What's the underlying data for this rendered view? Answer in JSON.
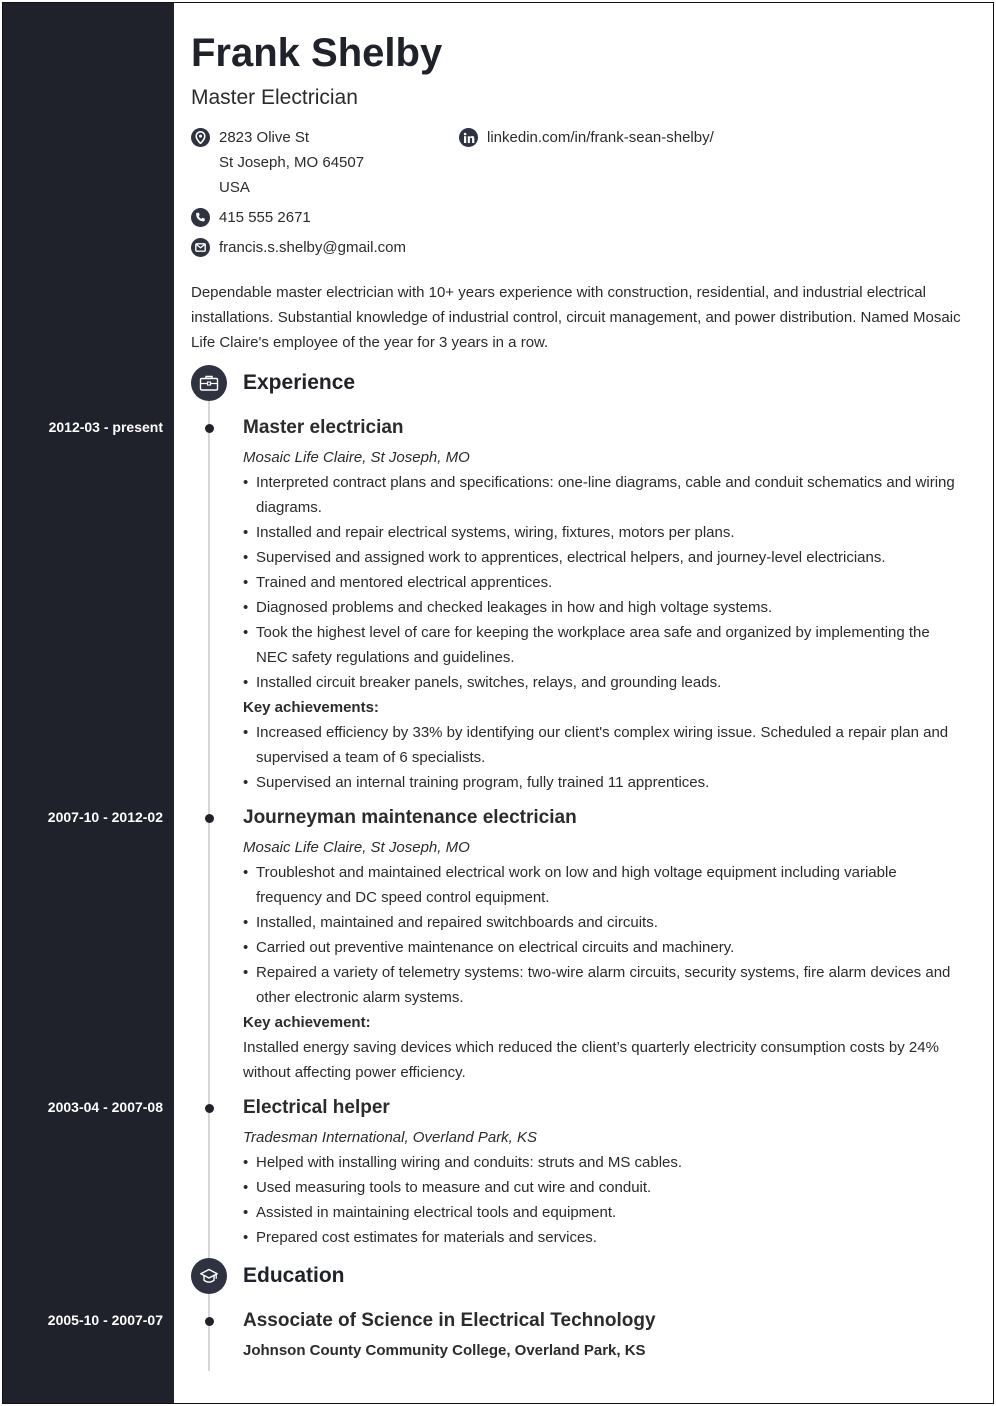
{
  "header": {
    "name": "Frank Shelby",
    "title": "Master Electrician"
  },
  "contact": {
    "address_line1": "2823 Olive St",
    "address_line2": "St Joseph, MO 64507",
    "address_line3": "USA",
    "phone": "415 555 2671",
    "email": "francis.s.shelby@gmail.com",
    "linkedin": "linkedin.com/in/frank-sean-shelby/",
    "icons": [
      "location-icon",
      "phone-icon",
      "email-icon",
      "linkedin-icon"
    ]
  },
  "summary": "Dependable master electrician with 10+ years experience with construction, residential, and industrial electrical installations. Substantial knowledge of industrial control, circuit management, and power distribution. Named Mosaic Life Claire's employee of the year for 3 years in a row.",
  "experience": {
    "heading": "Experience",
    "icon": "briefcase-icon",
    "jobs": [
      {
        "date": "2012-03 - present",
        "role": "Master electrician",
        "company": "Mosaic Life Claire, St Joseph, MO",
        "bullets": [
          "Interpreted contract plans and specifications: one-line diagrams, cable and conduit schematics and wiring diagrams.",
          "Installed and repair electrical systems, wiring, fixtures, motors per plans.",
          "Supervised and assigned work to apprentices, electrical helpers, and journey-level electricians.",
          "Trained and mentored electrical apprentices.",
          "Diagnosed problems and checked leakages in how and high voltage systems.",
          "Took the highest level of care for keeping the workplace area safe and organized by implementing the NEC safety regulations and guidelines.",
          "Installed circuit breaker panels, switches, relays, and grounding leads."
        ],
        "achievements_heading": "Key achievements:",
        "achievements": [
          "Increased efficiency by 33% by identifying our client's complex wiring issue. Scheduled a repair plan and supervised a team of 6 specialists.",
          "Supervised an internal training program, fully trained 11 apprentices."
        ]
      },
      {
        "date": "2007-10 - 2012-02",
        "role": "Journeyman maintenance electrician",
        "company": "Mosaic Life Claire, St Joseph, MO",
        "bullets": [
          "Troubleshot and maintained electrical work on low and high voltage equipment including variable frequency and DC speed control equipment.",
          "Installed, maintained and repaired switchboards and circuits.",
          "Carried out preventive maintenance on electrical circuits and machinery.",
          "Repaired a variety of telemetry systems: two-wire alarm circuits, security systems, fire alarm devices and other electronic alarm systems."
        ],
        "achievements_heading": "Key achievement:",
        "achievement_text": "Installed energy saving devices which reduced the client’s quarterly electricity consumption costs by 24% without affecting power efficiency."
      },
      {
        "date": "2003-04 - 2007-08",
        "role": "Electrical helper",
        "company": "Tradesman International, Overland Park, KS",
        "bullets": [
          "Helped with installing wiring and conduits: struts and MS cables.",
          "Used measuring tools to measure and cut wire and conduit.",
          "Assisted in maintaining electrical tools and equipment.",
          "Prepared cost estimates for materials and services."
        ]
      }
    ]
  },
  "education": {
    "heading": "Education",
    "icon": "graduation-cap-icon",
    "items": [
      {
        "date": "2005-10 - 2007-07",
        "degree": "Associate of Science in Electrical Technology",
        "school": "Johnson County Community College, Overland Park, KS"
      }
    ]
  }
}
